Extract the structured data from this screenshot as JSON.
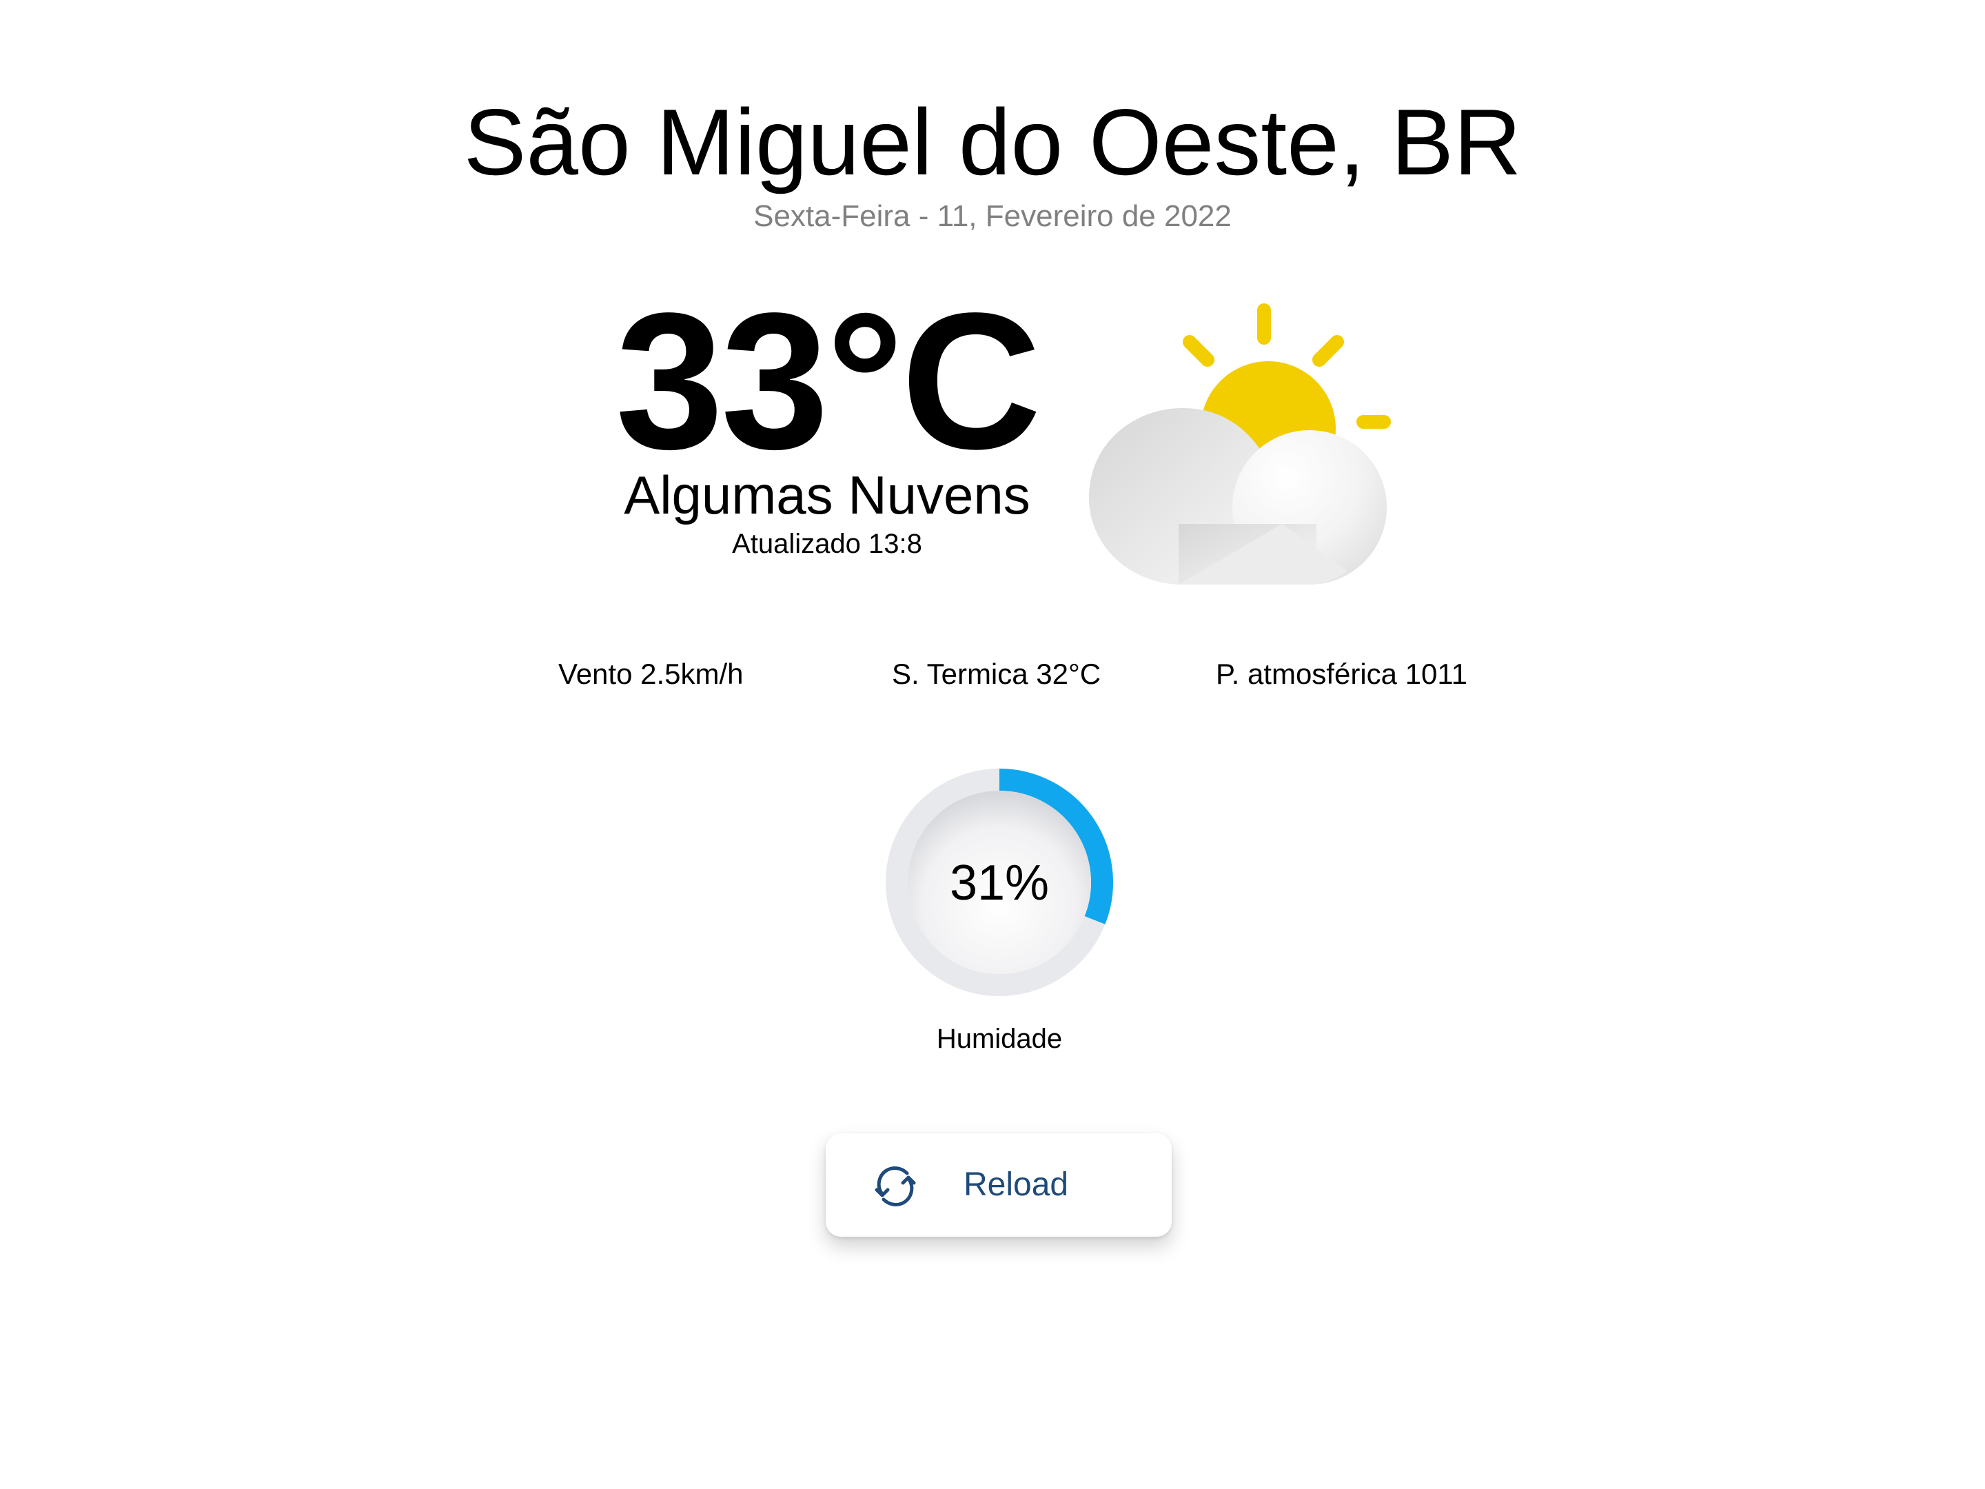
{
  "location": {
    "city": "São Miguel do Oeste, BR",
    "date": "Sexta-Feira - 11, Fevereiro de 2022"
  },
  "current": {
    "temperature": "33°C",
    "description": "Algumas Nuvens",
    "updated": "Atualizado 13:8",
    "icon": "sun-behind-cloud-icon"
  },
  "stats": {
    "wind": "Vento 2.5km/h",
    "feels_like": "S. Termica 32°C",
    "pressure": "P. atmosférica 1011"
  },
  "humidity": {
    "value_text": "31%",
    "fraction": 0.31,
    "label": "Humidade"
  },
  "reload": {
    "label": "Reload",
    "icon": "refresh-icon"
  },
  "colors": {
    "sun": "#f2cd00",
    "gauge_fill": "#10a7ef",
    "gauge_track": "#e8e9ed",
    "button_text": "#1f4a7a",
    "subtitle": "#808080"
  }
}
